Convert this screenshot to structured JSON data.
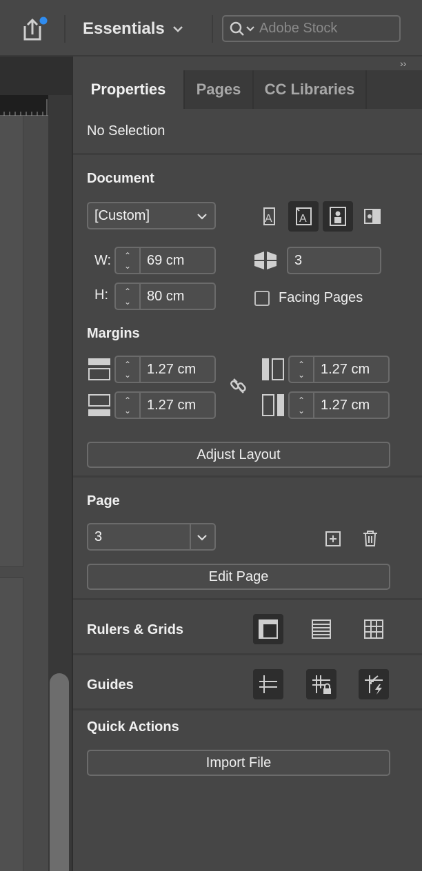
{
  "topbar": {
    "workspace": "Essentials",
    "search_placeholder": "Adobe Stock"
  },
  "panel": {
    "tabs": [
      {
        "label": "Properties",
        "active": true
      },
      {
        "label": "Pages",
        "active": false
      },
      {
        "label": "CC Libraries",
        "active": false
      }
    ],
    "selection_status": "No Selection",
    "document": {
      "title": "Document",
      "preset": "[Custom]",
      "width_label": "W:",
      "width": "69 cm",
      "height_label": "H:",
      "height": "80 cm",
      "pages_count": "3",
      "facing_pages_label": "Facing Pages",
      "facing_pages_checked": false
    },
    "margins": {
      "title": "Margins",
      "top": "1.27 cm",
      "bottom": "1.27 cm",
      "left": "1.27 cm",
      "right": "1.27 cm",
      "adjust_button": "Adjust Layout"
    },
    "page": {
      "title": "Page",
      "current": "3",
      "edit_button": "Edit Page"
    },
    "rulers_grids": {
      "title": "Rulers & Grids"
    },
    "guides": {
      "title": "Guides"
    },
    "quick_actions": {
      "title": "Quick Actions",
      "import_button": "Import File"
    }
  },
  "colors": {
    "panel_bg": "#464646",
    "notification_dot": "#2f8cf0"
  }
}
